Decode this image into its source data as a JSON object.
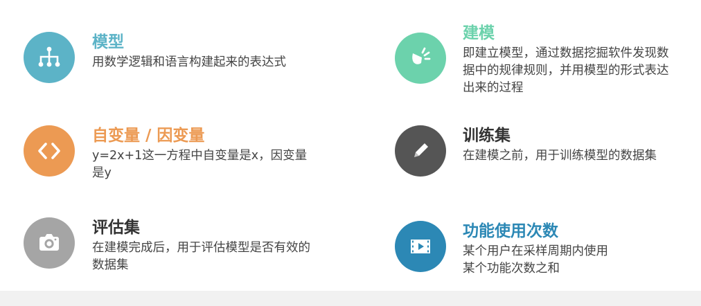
{
  "colors": {
    "model": "#5cb3c7",
    "modeling": "#6cd2ac",
    "variable": "#ec9a53",
    "training": "#555555",
    "evaluation": "#a5a5a5",
    "usage": "#2c88b5",
    "title_default": "#333333",
    "text": "#444444"
  },
  "items": [
    {
      "icon": "hierarchy-icon",
      "title": "模型",
      "desc": "用数学逻辑和语言构建起来的表达式"
    },
    {
      "icon": "code-icon",
      "title": "自变量 / 因变量",
      "desc": "y=2x+1这一方程中自变量是x，因变量是y"
    },
    {
      "icon": "camera-icon",
      "title": "评估集",
      "desc": "在建模完成后，用于评估模型是否有效的数据集"
    },
    {
      "icon": "cone-light-icon",
      "title": "建模",
      "desc": "即建立模型，通过数据挖掘软件发现数据中的规律规则，并用模型的形式表达出来的过程"
    },
    {
      "icon": "pencil-icon",
      "title": "训练集",
      "desc": "在建模之前，用于训练模型的数据集"
    },
    {
      "icon": "video-icon",
      "title": "功能使用次数",
      "desc": "某个用户在采样周期内使用某个功能次数之和"
    }
  ]
}
